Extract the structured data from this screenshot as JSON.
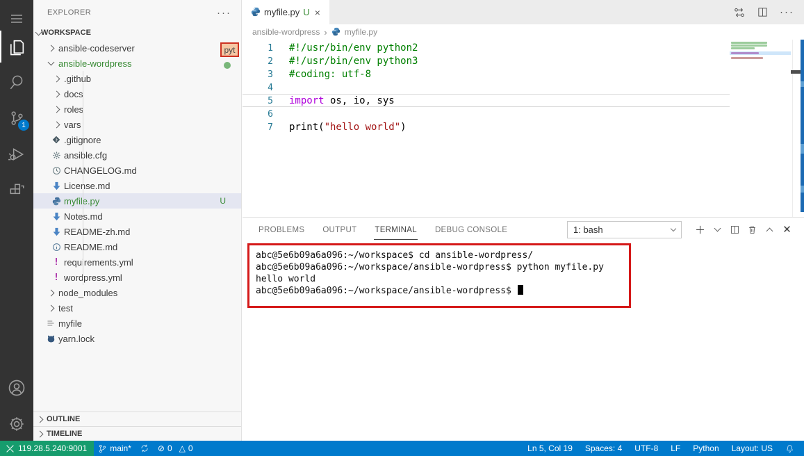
{
  "colors": {
    "accent": "#007acc",
    "remote_bg": "#169c6d",
    "git_green": "#388a34",
    "annotation_red": "#d51919",
    "activitybar_bg": "#333333",
    "badge_blue": "#007acc",
    "keyword": "#af00db",
    "comment": "#008000",
    "string": "#a31515",
    "line_number": "#237893"
  },
  "activity_bar": {
    "items": [
      {
        "icon": "menu-icon"
      },
      {
        "icon": "explorer-files-icon",
        "active": true
      },
      {
        "icon": "search-icon"
      },
      {
        "icon": "source-control-icon",
        "badge": "1"
      },
      {
        "icon": "run-debug-icon"
      },
      {
        "icon": "extensions-icon"
      },
      {
        "icon": "account-icon"
      },
      {
        "icon": "settings-gear-icon"
      }
    ],
    "scm_badge": "1"
  },
  "explorer": {
    "title": "EXPLORER",
    "more_actions": "···",
    "workspace_label": "WORKSPACE",
    "tree": [
      {
        "label": "ansible-codeserver",
        "level": 1,
        "chevron": "right"
      },
      {
        "label": "ansible-wordpress",
        "level": 1,
        "chevron": "down",
        "color": "green"
      },
      {
        "label": ".github",
        "level": 2,
        "chevron": "right"
      },
      {
        "label": "docs",
        "level": 2,
        "chevron": "right"
      },
      {
        "label": "roles",
        "level": 2,
        "chevron": "right"
      },
      {
        "label": "vars",
        "level": 2,
        "chevron": "right"
      },
      {
        "label": ".gitignore",
        "level": 2,
        "icon": "git-icon"
      },
      {
        "label": "ansible.cfg",
        "level": 2,
        "icon": "gear-file-icon"
      },
      {
        "label": "CHANGELOG.md",
        "level": 2,
        "icon": "clock-icon"
      },
      {
        "label": "License.md",
        "level": 2,
        "icon": "markdown-icon"
      },
      {
        "label": "myfile.py",
        "level": 2,
        "icon": "python-icon",
        "color": "green",
        "badge": "U",
        "selected": true
      },
      {
        "label": "Notes.md",
        "level": 2,
        "icon": "markdown-icon"
      },
      {
        "label": "README-zh.md",
        "level": 2,
        "icon": "markdown-icon"
      },
      {
        "label": "README.md",
        "level": 2,
        "icon": "info-icon"
      },
      {
        "label": "requirements.yml",
        "level": 2,
        "icon": "exclamation-icon"
      },
      {
        "label": "wordpress.yml",
        "level": 2,
        "icon": "exclamation-icon"
      },
      {
        "label": "node_modules",
        "level": 1,
        "chevron": "right"
      },
      {
        "label": "test",
        "level": 1,
        "chevron": "right"
      },
      {
        "label": "myfile",
        "level": 1,
        "icon": "text-lines-icon"
      },
      {
        "label": "yarn.lock",
        "level": 1,
        "icon": "yarn-cat-icon"
      }
    ],
    "outline_label": "OUTLINE",
    "timeline_label": "TIMELINE"
  },
  "annotations": {
    "pyt_badge": "pyt"
  },
  "editor": {
    "tab": {
      "icon": "python-icon",
      "label": "myfile.py",
      "modified_indicator": "U",
      "close": "×"
    },
    "actions": {
      "open_changes_icon": "open-changes-icon",
      "split_icon": "split-editor-icon",
      "more": "···"
    },
    "breadcrumb": {
      "folder": "ansible-wordpress",
      "separator": "›",
      "file_icon": "python-icon",
      "file": "myfile.py"
    },
    "lines": [
      {
        "num": "1",
        "segments": [
          [
            "c",
            "#!/usr/bin/env python2"
          ]
        ]
      },
      {
        "num": "2",
        "segments": [
          [
            "c",
            "#!/usr/bin/env python3"
          ]
        ]
      },
      {
        "num": "3",
        "segments": [
          [
            "c",
            "#coding: utf-8"
          ]
        ]
      },
      {
        "num": "4",
        "segments": []
      },
      {
        "num": "5",
        "segments": [
          [
            "k",
            "import"
          ],
          [
            "p",
            " os, io, sys"
          ]
        ],
        "current": true
      },
      {
        "num": "6",
        "segments": []
      },
      {
        "num": "7",
        "segments": [
          [
            "p",
            "print("
          ],
          [
            "s",
            "\"hello world\""
          ],
          [
            "p",
            ")"
          ]
        ]
      }
    ]
  },
  "panel": {
    "tabs": [
      {
        "label": "PROBLEMS"
      },
      {
        "label": "OUTPUT"
      },
      {
        "label": "TERMINAL",
        "active": true
      },
      {
        "label": "DEBUG CONSOLE"
      }
    ],
    "terminal_select_value": "1: bash",
    "terminal_lines": [
      "abc@5e6b09a6a096:~/workspace$ cd ansible-wordpress/",
      "abc@5e6b09a6a096:~/workspace/ansible-wordpress$ python myfile.py",
      "hello world",
      "abc@5e6b09a6a096:~/workspace/ansible-wordpress$ "
    ]
  },
  "status_bar": {
    "remote": "119.28.5.240:9001",
    "branch": "main*",
    "errors": "0",
    "warnings": "0",
    "error_glyph": "⊘",
    "warning_glyph": "△",
    "right": [
      "Ln 5, Col 19",
      "Spaces: 4",
      "UTF-8",
      "LF",
      "Python",
      "Layout: US"
    ]
  }
}
